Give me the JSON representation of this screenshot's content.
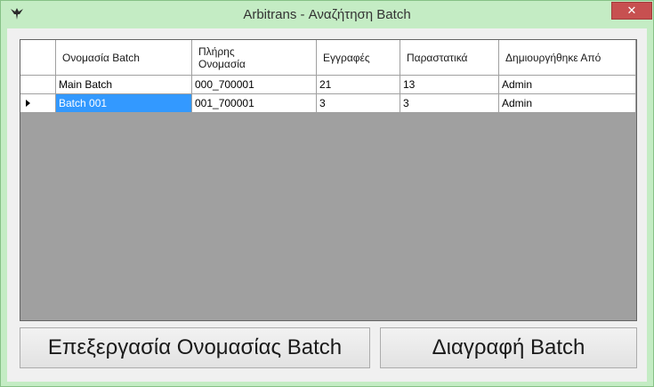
{
  "window": {
    "title": "Arbitrans - Αναζήτηση Batch",
    "close_label": "✕"
  },
  "grid": {
    "columns": [
      "Ονομασία Batch",
      "Πλήρης\nΟνομασία",
      "Εγγραφές",
      "Παραστατικά",
      "Δημιουργήθηκε Από"
    ],
    "rows": [
      {
        "name": "Main Batch",
        "full_name": "000_700001",
        "records": "21",
        "documents": "13",
        "created_by": "Admin",
        "current": false
      },
      {
        "name": "Batch 001",
        "full_name": "001_700001",
        "records": "3",
        "documents": "3",
        "created_by": "Admin",
        "current": true
      }
    ],
    "colors": {
      "selection": "#3399ff",
      "empty_area": "#a0a0a0"
    }
  },
  "buttons": {
    "edit_label": "Επεξεργασία Ονομασίας Batch",
    "delete_label": "Διαγραφή Batch"
  },
  "colors": {
    "frame": "#c4ecc4",
    "close": "#c75050"
  }
}
